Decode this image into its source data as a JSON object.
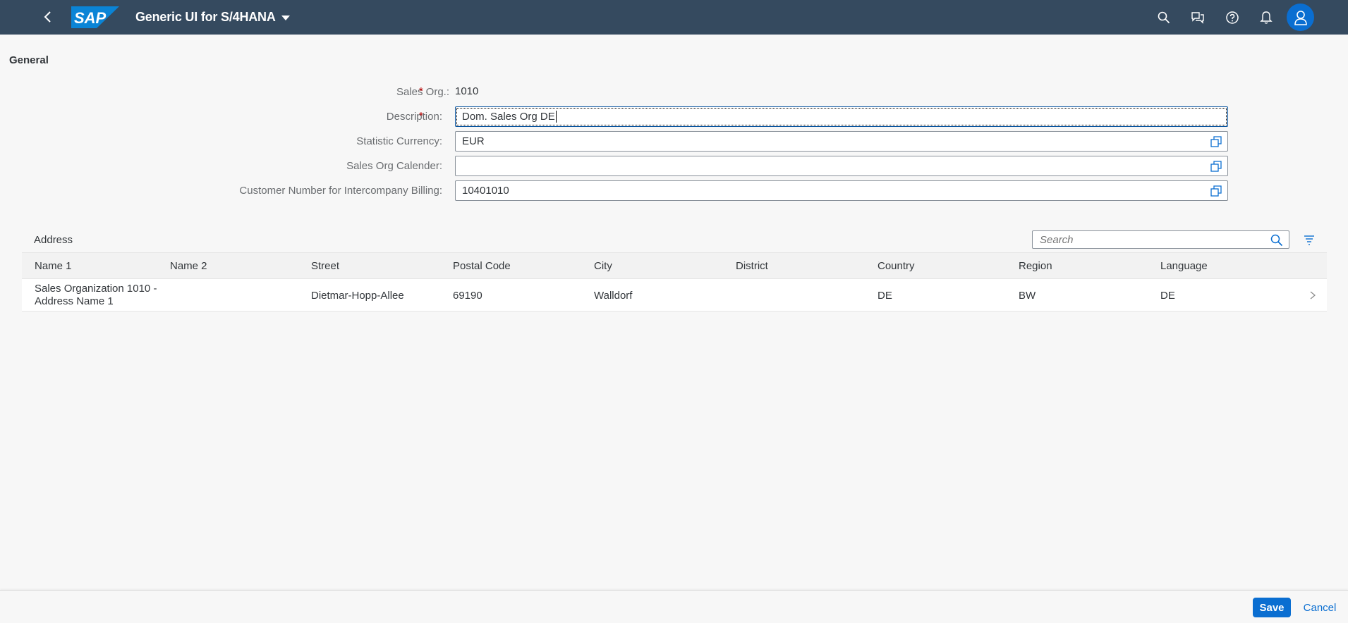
{
  "shell": {
    "title": "Generic UI for S/4HANA",
    "logo_text": "SAP",
    "icons": [
      "back-icon",
      "search-icon",
      "feedback-icon",
      "help-icon",
      "notifications-icon",
      "user-icon"
    ],
    "header_color": "#354a5f",
    "avatar_color": "#0a6ed1"
  },
  "general": {
    "title": "General",
    "fields": [
      {
        "label": "Sales Org.:",
        "required": true,
        "value": "1010",
        "editable": false
      },
      {
        "label": "Description:",
        "required": true,
        "value": "Dom. Sales Org DE",
        "editable": true,
        "value_help": false
      },
      {
        "label": "Statistic Currency:",
        "required": false,
        "value": "EUR",
        "editable": true,
        "value_help": true
      },
      {
        "label": "Sales Org Calender:",
        "required": false,
        "value": "",
        "editable": true,
        "value_help": true
      },
      {
        "label": "Customer Number for Intercompany Billing:",
        "required": false,
        "value": "10401010",
        "editable": true,
        "value_help": true
      }
    ]
  },
  "address": {
    "title": "Address",
    "search_placeholder": "Search",
    "columns": [
      "Name 1",
      "Name 2",
      "Street",
      "Postal Code",
      "City",
      "District",
      "Country",
      "Region",
      "Language"
    ],
    "rows": [
      {
        "name1": "Sales Organization 1010 - Address Name 1",
        "name2": "",
        "street": "Dietmar-Hopp-Allee",
        "postal_code": "69190",
        "city": "Walldorf",
        "district": "",
        "country": "DE",
        "region": "BW",
        "language": "DE"
      }
    ]
  },
  "footer": {
    "save_label": "Save",
    "cancel_label": "Cancel",
    "accent": "#0a6ed1"
  }
}
